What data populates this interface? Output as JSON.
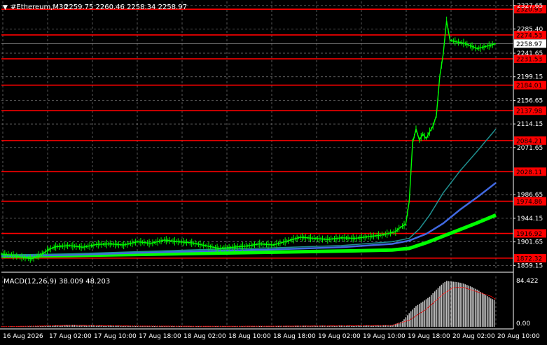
{
  "header": {
    "symbol": "#Ethereum,M30",
    "ohlc": "2259.75 2260.46 2258.34 2258.97"
  },
  "indicator": {
    "label": "MACD(12,26,9) 38.009 48.203",
    "scale_top": "84.422",
    "scale_bottom": "0.00"
  },
  "colors": {
    "background": "#000000",
    "grid": "#7f7f7f",
    "candles": "#00ff00",
    "level_line": "#ff0000",
    "level_label_bg": "#ff0000",
    "ma_fast": "#1f8f8f",
    "ma_mid": "#4169e1",
    "ma_slow": "#00ff00",
    "macd_hist": "#c0c0c0",
    "macd_signal": "#ff0000",
    "price_tag_bg": "#ffffff",
    "axis_text": "#ffffff"
  },
  "chart_data": {
    "type": "line",
    "price_axis_ticks": [
      "2327.65",
      "2285.40",
      "2241.65",
      "2199.15",
      "2156.65",
      "2114.15",
      "2071.65",
      "1986.65",
      "1944.15",
      "1901.65",
      "1859.15"
    ],
    "ylim": [
      1852,
      2335
    ],
    "time_axis_ticks": [
      "16 Aug 2026",
      "17 Aug 02:00",
      "17 Aug 10:00",
      "17 Aug 18:00",
      "18 Aug 02:00",
      "18 Aug 10:00",
      "18 Aug 18:00",
      "19 Aug 02:00",
      "19 Aug 10:00",
      "19 Aug 18:00",
      "20 Aug 02:00",
      "20 Aug 10:00"
    ],
    "current_price": "2258.97",
    "levels": [
      "2320.93",
      "2274.53",
      "2231.53",
      "2184.01",
      "2137.98",
      "2084.21",
      "2028.11",
      "1974.86",
      "1916.92",
      "1872.32"
    ],
    "price": [
      [
        0,
        1880
      ],
      [
        6,
        1878
      ],
      [
        12,
        1874
      ],
      [
        18,
        1871
      ],
      [
        24,
        1880
      ],
      [
        28,
        1888
      ],
      [
        32,
        1893
      ],
      [
        40,
        1895
      ],
      [
        48,
        1892
      ],
      [
        56,
        1897
      ],
      [
        64,
        1898
      ],
      [
        72,
        1896
      ],
      [
        80,
        1902
      ],
      [
        88,
        1899
      ],
      [
        96,
        1905
      ],
      [
        104,
        1902
      ],
      [
        112,
        1900
      ],
      [
        120,
        1895
      ],
      [
        128,
        1890
      ],
      [
        136,
        1892
      ],
      [
        144,
        1894
      ],
      [
        152,
        1898
      ],
      [
        160,
        1896
      ],
      [
        168,
        1903
      ],
      [
        176,
        1910
      ],
      [
        184,
        1908
      ],
      [
        192,
        1906
      ],
      [
        200,
        1909
      ],
      [
        208,
        1908
      ],
      [
        216,
        1911
      ],
      [
        224,
        1914
      ],
      [
        232,
        1920
      ],
      [
        234,
        1926
      ],
      [
        236,
        1930
      ],
      [
        238,
        1934
      ],
      [
        240,
        1975
      ],
      [
        242,
        2080
      ],
      [
        244,
        2105
      ],
      [
        246,
        2085
      ],
      [
        248,
        2096
      ],
      [
        250,
        2088
      ],
      [
        252,
        2100
      ],
      [
        254,
        2110
      ],
      [
        256,
        2130
      ],
      [
        258,
        2200
      ],
      [
        260,
        2240
      ],
      [
        262,
        2300
      ],
      [
        264,
        2265
      ],
      [
        268,
        2262
      ],
      [
        272,
        2260
      ],
      [
        276,
        2255
      ],
      [
        280,
        2250
      ],
      [
        284,
        2253
      ],
      [
        288,
        2256
      ],
      [
        291,
        2258.97
      ]
    ],
    "ma_fast": [
      [
        0,
        1878
      ],
      [
        40,
        1880
      ],
      [
        80,
        1884
      ],
      [
        120,
        1888
      ],
      [
        160,
        1891
      ],
      [
        200,
        1895
      ],
      [
        230,
        1902
      ],
      [
        240,
        1908
      ],
      [
        246,
        1925
      ],
      [
        252,
        1950
      ],
      [
        260,
        1990
      ],
      [
        270,
        2030
      ],
      [
        280,
        2065
      ],
      [
        291,
        2105
      ]
    ],
    "ma_mid": [
      [
        0,
        1876
      ],
      [
        40,
        1878
      ],
      [
        80,
        1882
      ],
      [
        120,
        1885
      ],
      [
        160,
        1888
      ],
      [
        200,
        1892
      ],
      [
        230,
        1898
      ],
      [
        240,
        1904
      ],
      [
        250,
        1916
      ],
      [
        260,
        1935
      ],
      [
        270,
        1960
      ],
      [
        280,
        1982
      ],
      [
        291,
        2008
      ]
    ],
    "ma_slow": [
      [
        0,
        1876
      ],
      [
        40,
        1877
      ],
      [
        80,
        1879
      ],
      [
        120,
        1881
      ],
      [
        160,
        1883
      ],
      [
        200,
        1885
      ],
      [
        230,
        1887
      ],
      [
        240,
        1890
      ],
      [
        250,
        1900
      ],
      [
        260,
        1912
      ],
      [
        270,
        1924
      ],
      [
        280,
        1936
      ],
      [
        291,
        1950
      ]
    ],
    "macd_ylim": [
      0,
      84.422
    ],
    "macd_hist": [
      [
        0,
        0.5
      ],
      [
        20,
        1
      ],
      [
        40,
        3.5
      ],
      [
        60,
        2.5
      ],
      [
        80,
        1.5
      ],
      [
        100,
        1.2
      ],
      [
        120,
        1
      ],
      [
        140,
        0.8
      ],
      [
        160,
        1.5
      ],
      [
        180,
        2
      ],
      [
        200,
        2.2
      ],
      [
        220,
        2.5
      ],
      [
        230,
        3
      ],
      [
        236,
        10
      ],
      [
        240,
        25
      ],
      [
        244,
        38
      ],
      [
        248,
        46
      ],
      [
        252,
        55
      ],
      [
        256,
        68
      ],
      [
        260,
        80
      ],
      [
        262,
        84
      ],
      [
        264,
        83
      ],
      [
        268,
        82
      ],
      [
        272,
        79
      ],
      [
        276,
        74
      ],
      [
        280,
        68
      ],
      [
        284,
        60
      ],
      [
        288,
        52
      ],
      [
        291,
        48
      ]
    ],
    "macd_signal": [
      [
        0,
        0.3
      ],
      [
        40,
        2.5
      ],
      [
        80,
        1.5
      ],
      [
        120,
        0.9
      ],
      [
        160,
        1.2
      ],
      [
        200,
        1.8
      ],
      [
        230,
        2.5
      ],
      [
        240,
        12
      ],
      [
        250,
        32
      ],
      [
        260,
        60
      ],
      [
        266,
        72
      ],
      [
        272,
        72
      ],
      [
        280,
        64
      ],
      [
        288,
        56
      ],
      [
        291,
        50
      ]
    ]
  }
}
